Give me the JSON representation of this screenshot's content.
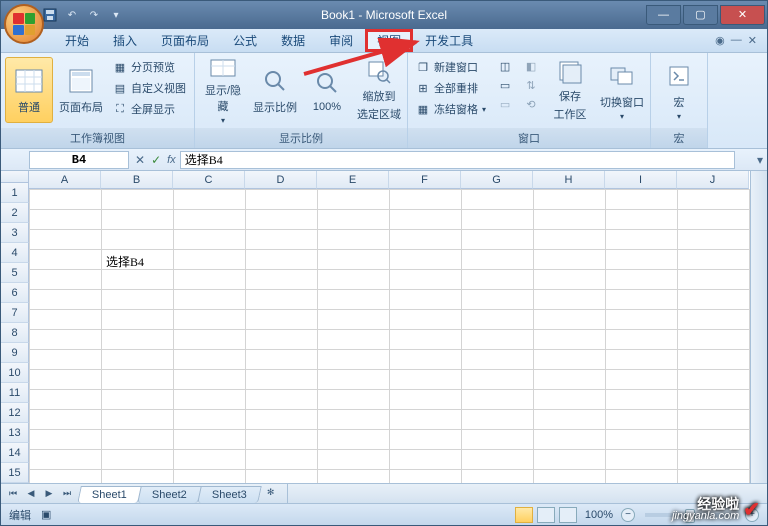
{
  "title": "Book1 - Microsoft Excel",
  "menu": {
    "items": [
      "开始",
      "插入",
      "页面布局",
      "公式",
      "数据",
      "审阅",
      "视图",
      "开发工具"
    ],
    "active_index": 6
  },
  "ribbon": {
    "group1": {
      "label": "工作簿视图",
      "normal": "普通",
      "page_layout": "页面布局",
      "page_break": "分页预览",
      "custom_view": "自定义视图",
      "fullscreen": "全屏显示"
    },
    "group2": {
      "label": "显示比例",
      "show_hide": "显示/隐藏",
      "zoom": "显示比例",
      "hundred": "100%",
      "zoom_to_sel_l1": "缩放到",
      "zoom_to_sel_l2": "选定区域"
    },
    "group3": {
      "label": "窗口",
      "new_win": "新建窗口",
      "arrange": "全部重排",
      "freeze": "冻结窗格",
      "save_ws_l1": "保存",
      "save_ws_l2": "工作区",
      "switch": "切换窗口"
    },
    "group4": {
      "label": "宏",
      "macro": "宏"
    }
  },
  "namebox": "B4",
  "formula": "选择B4",
  "columns": [
    "A",
    "B",
    "C",
    "D",
    "E",
    "F",
    "G",
    "H",
    "I",
    "J"
  ],
  "rows": 15,
  "cell_b4": "选择B4",
  "sheets": [
    "Sheet1",
    "Sheet2",
    "Sheet3"
  ],
  "active_sheet": 0,
  "status": "编辑",
  "zoom": "100%",
  "watermark": {
    "brand": "经验啦",
    "url": "jingyanla.com"
  }
}
